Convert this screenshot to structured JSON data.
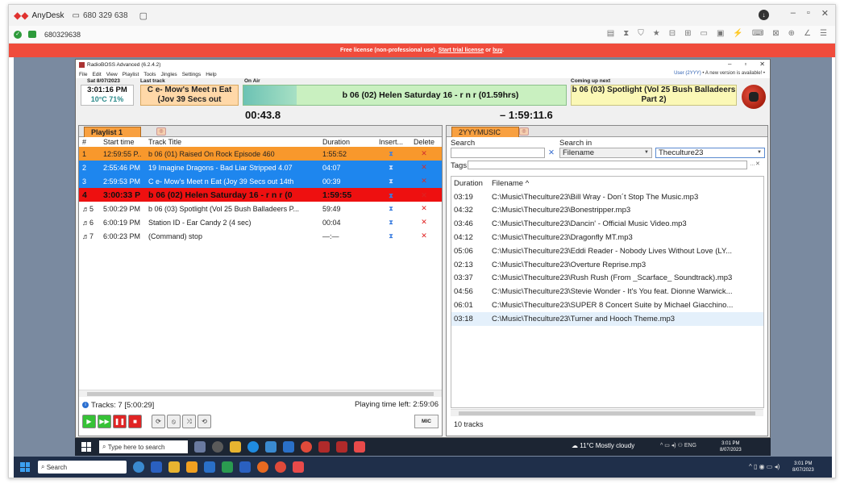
{
  "anydesk": {
    "app_name": "AnyDesk",
    "session_label": "680 329 638",
    "id_label": "680329638",
    "license_text": "Free license (non-professional use). ",
    "license_link1": "Start trial license",
    "license_mid": " or ",
    "license_link2": "buy",
    "license_end": "."
  },
  "radioboss": {
    "title": "RadioBOSS Advanced (6.2.4.2)",
    "menu": [
      "File",
      "Edit",
      "View",
      "Playlist",
      "Tools",
      "Jingles",
      "Settings",
      "Help"
    ],
    "user": "User (2YYY)",
    "update_notice": "• A new version is available! •",
    "date_label": "Sat 8/07/2023",
    "time": "3:01:16 PM",
    "weather": "10°C 71%",
    "last_track_label": "Last track",
    "last_track": "C e- Mow's Meet n Eat (Jov 39 Secs out",
    "on_air_label": "On Air",
    "on_air": "b 06 (02) Helen Saturday 16 - r n r (01.59hrs)",
    "coming_label": "Coming up next",
    "coming": "b 06 (03) Spotlight (Vol 25 Bush Balladeers Part 2)",
    "elapsed": "00:43.8",
    "remaining": "– 1:59:11.6"
  },
  "playlist": {
    "tab": "Playlist 1",
    "headers": {
      "num": "#",
      "start": "Start time",
      "title": "Track Title",
      "duration": "Duration",
      "insert": "Insert...",
      "delete": "Delete"
    },
    "rows": [
      {
        "num": "1",
        "start": "12:59:55 P..",
        "title": "b 06 (01) Raised On Rock Episode 460",
        "duration": "1:55:52",
        "style": "orange"
      },
      {
        "num": "2",
        "start": "2:55:46 PM",
        "title": "19 Imagine Dragons - Bad Liar Stripped 4.07",
        "duration": "04:07",
        "style": "blue"
      },
      {
        "num": "3",
        "start": "2:59:53 PM",
        "title": "C e- Mow's Meet n Eat (Joy 39 Secs out 14th",
        "duration": "00:39",
        "style": "blue"
      },
      {
        "num": "4",
        "start": "3:00:33 P",
        "title": "b 06 (02) Helen Saturday 16 - r n r (0",
        "duration": "1:59:55",
        "style": "red"
      },
      {
        "num": "♬5",
        "start": "5:00:29 PM",
        "title": "b 06 (03) Spotlight (Vol 25 Bush Balladeers P...",
        "duration": "59:49",
        "style": "white"
      },
      {
        "num": "♬6",
        "start": "6:00:19 PM",
        "title": "Station ID - Ear Candy 2 (4 sec)",
        "duration": "00:04",
        "style": "white"
      },
      {
        "num": "♬7",
        "start": "6:00:23 PM",
        "title": "(Command) stop",
        "duration": "—:—",
        "style": "white"
      }
    ],
    "status_tracks": "Tracks: 7 [5:00:29]",
    "playing_left": "Playing time left: 2:59:06",
    "mic": "MIC"
  },
  "library": {
    "tab": "2YYYMUSIC",
    "search_label": "Search",
    "search_in_label": "Search in",
    "search_in_value": "Filename",
    "folder_value": "Theculture23",
    "tags_label": "Tags",
    "headers": {
      "duration": "Duration",
      "filename": "Filename ^"
    },
    "rows": [
      {
        "duration": "03:19",
        "filename": "C:\\Music\\Theculture23\\Bill Wray - Don´t Stop The Music.mp3"
      },
      {
        "duration": "04:32",
        "filename": "C:\\Music\\Theculture23\\Bonestripper.mp3"
      },
      {
        "duration": "03:46",
        "filename": "C:\\Music\\Theculture23\\Dancin' - Official Music Video.mp3"
      },
      {
        "duration": "04:12",
        "filename": "C:\\Music\\Theculture23\\Dragonfly MT.mp3"
      },
      {
        "duration": "05:06",
        "filename": "C:\\Music\\Theculture23\\Eddi Reader - Nobody Lives Without Love (LY..."
      },
      {
        "duration": "02:13",
        "filename": "C:\\Music\\Theculture23\\Overture Reprise.mp3"
      },
      {
        "duration": "03:37",
        "filename": "C:\\Music\\Theculture23\\Rush Rush (From _Scarface_ Soundtrack).mp3"
      },
      {
        "duration": "04:56",
        "filename": "C:\\Music\\Theculture23\\Stevie Wonder - It's You feat. Dionne Warwick..."
      },
      {
        "duration": "06:01",
        "filename": "C:\\Music\\Theculture23\\SUPER 8 Concert Suite by Michael Giacchino..."
      },
      {
        "duration": "03:18",
        "filename": "C:\\Music\\Theculture23\\Turner and Hooch Theme.mp3"
      }
    ],
    "count": "10 tracks"
  },
  "remote_taskbar": {
    "search_placeholder": "Type here to search",
    "weather": "11°C  Mostly cloudy",
    "lang": "ENG",
    "time": "3:01 PM",
    "date": "8/07/2023"
  },
  "local_taskbar": {
    "search_placeholder": "Search",
    "time": "3:01 PM",
    "date": "8/07/2023"
  }
}
